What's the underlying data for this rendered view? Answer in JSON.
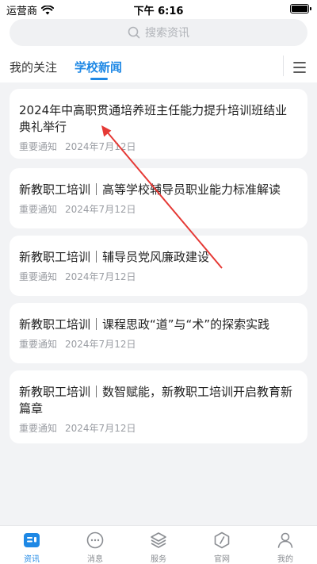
{
  "status_bar": {
    "carrier": "运营商",
    "time": "下午 6:16"
  },
  "search": {
    "placeholder": "搜索资讯"
  },
  "tabs": [
    {
      "label": "我的关注",
      "active": false
    },
    {
      "label": "学校新闻",
      "active": true
    }
  ],
  "news": [
    {
      "title": "2024年中高职贯通培养班主任能力提升培训班结业典礼举行",
      "tag": "重要通知",
      "date": "2024年7月12日"
    },
    {
      "title": "新教职工培训｜高等学校辅导员职业能力标准解读",
      "tag": "重要通知",
      "date": "2024年7月12日"
    },
    {
      "title": "新教职工培训｜辅导员党风廉政建设",
      "tag": "重要通知",
      "date": "2024年7月12日"
    },
    {
      "title": "新教职工培训｜课程思政“道”与“术”的探索实践",
      "tag": "重要通知",
      "date": "2024年7月12日"
    },
    {
      "title": "新教职工培训｜数智赋能，新教职工培训开启教育新篇章",
      "tag": "重要通知",
      "date": "2024年7月12日"
    }
  ],
  "bottom_nav": [
    {
      "label": "资讯",
      "icon": "news-icon",
      "active": true
    },
    {
      "label": "消息",
      "icon": "message-icon",
      "active": false
    },
    {
      "label": "服务",
      "icon": "layers-icon",
      "active": false
    },
    {
      "label": "官网",
      "icon": "compass-icon",
      "active": false
    },
    {
      "label": "我的",
      "icon": "user-icon",
      "active": false
    }
  ],
  "colors": {
    "accent": "#1e88e5",
    "annotation": "#e53935",
    "background": "#f2f3f5"
  }
}
